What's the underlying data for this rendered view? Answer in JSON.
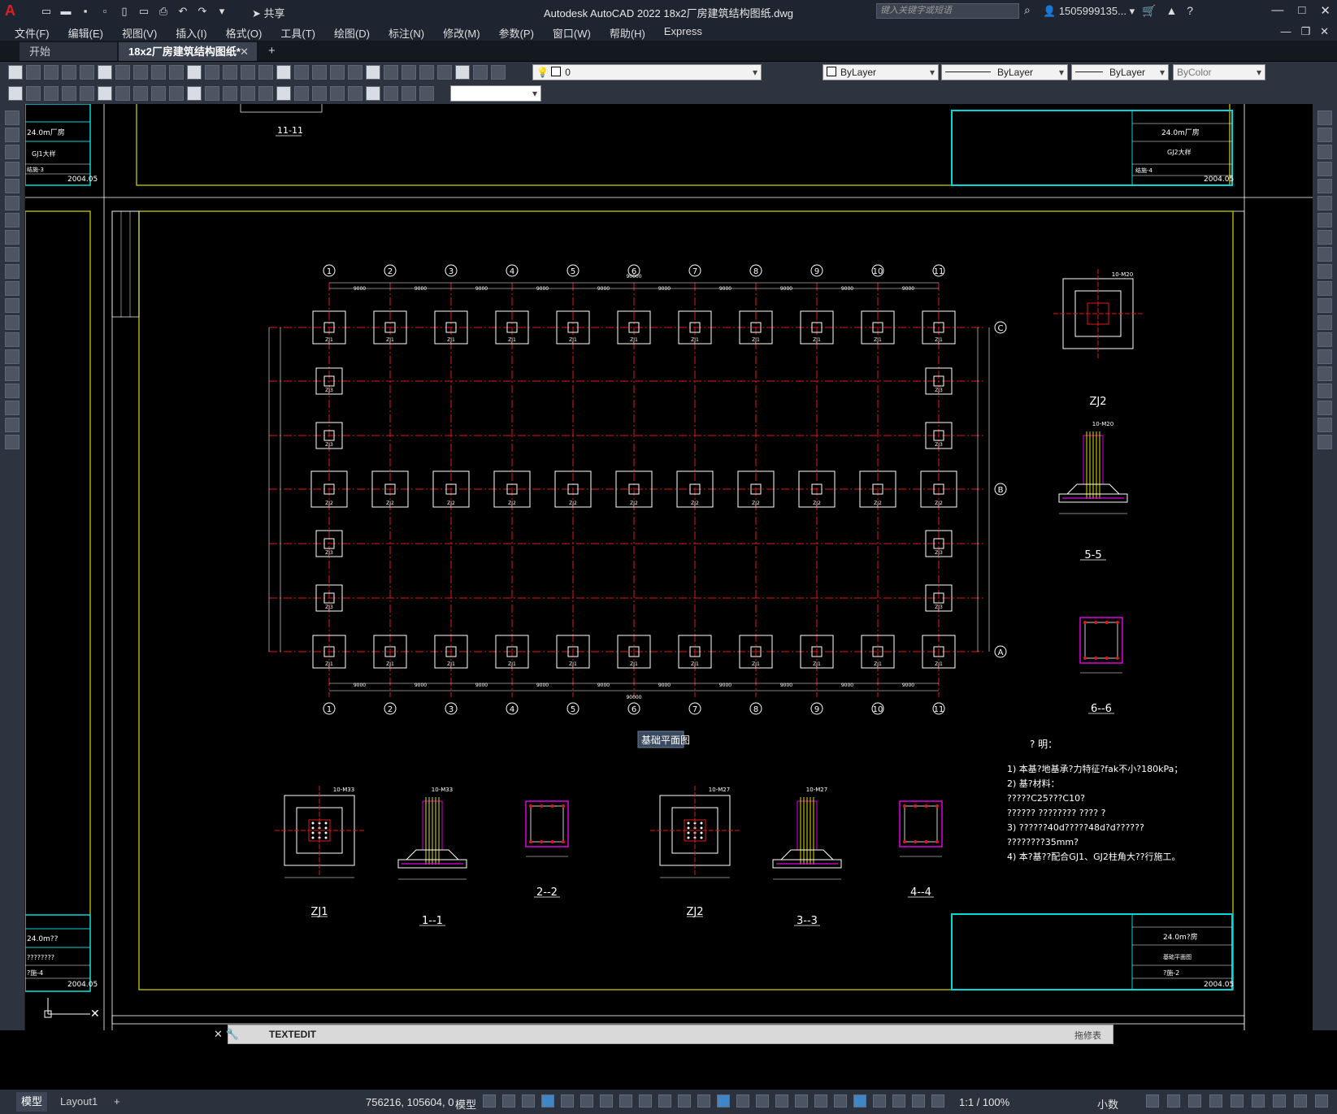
{
  "app": {
    "title": "Autodesk AutoCAD 2022    18x2厂房建筑结构图纸.dwg",
    "share": "共享",
    "search_placeholder": "键入关键字或短语",
    "user": "1505999135...",
    "logo": "A"
  },
  "menu": [
    "文件(F)",
    "编辑(E)",
    "视图(V)",
    "插入(I)",
    "格式(O)",
    "工具(T)",
    "绘图(D)",
    "标注(N)",
    "修改(M)",
    "参数(P)",
    "窗口(W)",
    "帮助(H)",
    "Express"
  ],
  "tabs": {
    "start": "开始",
    "document": "18x2厂房建筑结构图纸*",
    "close": "✕",
    "add": "+"
  },
  "properties": {
    "layer": "0",
    "color": "ByLayer",
    "linetype": "ByLayer",
    "lineweight": "ByLayer",
    "plotstyle": "ByColor"
  },
  "drawing": {
    "plan_title": "基础平面图",
    "section_top": "11-11",
    "axis_numbers": [
      "1",
      "2",
      "3",
      "4",
      "5",
      "6",
      "7",
      "8",
      "9",
      "10",
      "11"
    ],
    "axis_letters": [
      "C",
      "B",
      "A"
    ],
    "span_dim": "9000",
    "total_dim": "90000",
    "footing_labels": {
      "zj1": "ZJ1",
      "zj2": "ZJ2",
      "zj3": "ZJ3"
    },
    "detail_titles": [
      "ZJ1",
      "1--1",
      "2--2",
      "ZJ2",
      "3--3",
      "4--4"
    ],
    "right_detail_titles": [
      "ZJ2",
      "5-5",
      "6--6"
    ],
    "rebar_labels": [
      "10-M33",
      "10-M33",
      "10-M27",
      "10-M20"
    ],
    "notes_title": "? 明：",
    "notes": [
      "1) 本基?地基承?力特征?fak不小?180kPa；",
      "2) 基?材料：",
      "    ?????C25???C10?",
      "    ??????    ????????    ????    ?",
      "3) ??????40d?????48d?d??????",
      "    ????????35mm?",
      "4) 本?基??配合GJ1、GJ2柱角大??行施工。"
    ],
    "title_block_top": {
      "project": "24.0m厂房",
      "name": "GJ2大样",
      "no": "结施-4",
      "date": "2004.05"
    },
    "title_block_left_top": {
      "project": "24.0m厂房",
      "name": "GJ1大样",
      "no": "结施-3",
      "date": "2004.05"
    },
    "title_block_bottom": {
      "project": "24.0m?房",
      "name": "基础平面图",
      "no": "?施-2",
      "date": "2004.05"
    },
    "title_block_left_bottom": {
      "project": "24.0m??",
      "name": "????????",
      "no": "?施-4",
      "date": "2004.05"
    }
  },
  "command": {
    "prompt": "TEXTEDIT",
    "hint": "拖修表"
  },
  "status": {
    "model_tab": "模型",
    "layout_tab": "Layout1",
    "coords": "756216, 105604, 0",
    "mode": "模型",
    "scale": "1:1 / 100%",
    "units": "小数"
  },
  "colors": {
    "accent": "#3f86c9",
    "cyan_frame": "#00d8d8",
    "yellow_frame": "#d8d800",
    "red_grid": "#e01818",
    "magenta": "#e000e0"
  }
}
